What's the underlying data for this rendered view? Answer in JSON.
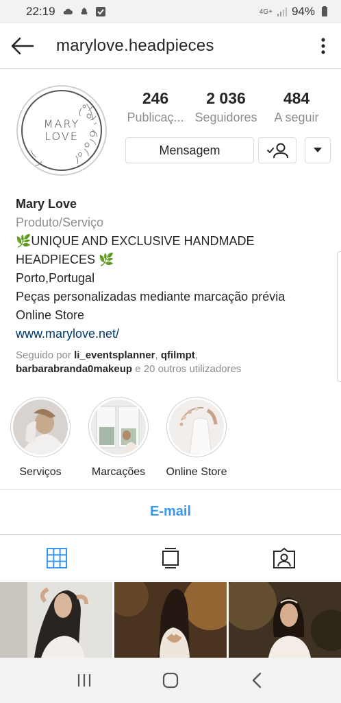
{
  "status_bar": {
    "time": "22:19",
    "network": "4G+",
    "battery": "94%"
  },
  "app_bar": {
    "username": "marylove.headpieces",
    "back_icon": "arrow-left-icon",
    "more_icon": "more-vertical-icon"
  },
  "profile": {
    "avatar_text": [
      "MARY",
      "LOVE"
    ],
    "stats": [
      {
        "value": "246",
        "label": "Publicaç..."
      },
      {
        "value": "2 036",
        "label": "Seguidores"
      },
      {
        "value": "484",
        "label": "A seguir"
      }
    ],
    "message_label": "Mensagem"
  },
  "bio": {
    "name": "Mary Love",
    "category": "Produto/Serviço",
    "line1": "🌿UNIQUE AND EXCLUSIVE HANDMADE",
    "line2": "HEADPIECES 🌿",
    "line3": "Porto,Portugal",
    "line4": "Peças personalizadas mediante marcação prévia",
    "line5": "Online Store",
    "link": "www.marylove.net/",
    "followed_prefix": "Seguido por ",
    "followed_user1": "li_eventsplanner",
    "followed_sep": ", ",
    "followed_user2": "qfilmpt",
    "followed_sep2": ",",
    "followed_user3": "barbarabranda0makeup",
    "followed_suffix": " e 20 outros utilizadores"
  },
  "highlights": [
    {
      "label": "Serviços"
    },
    {
      "label": "Marcações"
    },
    {
      "label": "Online Store"
    }
  ],
  "email_label": "E-mail",
  "colors": {
    "accent": "#3897f0",
    "link": "#00376b",
    "muted": "#8e8e8e"
  }
}
